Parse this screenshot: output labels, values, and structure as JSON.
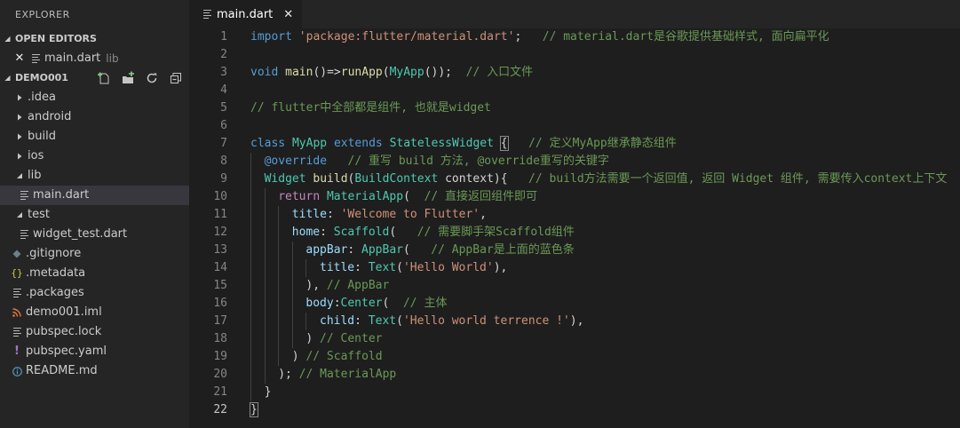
{
  "explorer": {
    "title": "EXPLORER",
    "open_editors": {
      "header": "OPEN EDITORS",
      "items": [
        {
          "name": "main.dart",
          "desc": "lib"
        }
      ]
    },
    "project": {
      "header": "DEMO001",
      "actions": [
        "new-file-icon",
        "new-folder-icon",
        "refresh-icon",
        "collapse-all-icon"
      ],
      "tree": [
        {
          "label": ".idea",
          "type": "folder",
          "expanded": false,
          "depth": 0
        },
        {
          "label": "android",
          "type": "folder",
          "expanded": false,
          "depth": 0
        },
        {
          "label": "build",
          "type": "folder",
          "expanded": false,
          "depth": 0
        },
        {
          "label": "ios",
          "type": "folder",
          "expanded": false,
          "depth": 0
        },
        {
          "label": "lib",
          "type": "folder",
          "expanded": true,
          "depth": 0
        },
        {
          "label": "main.dart",
          "type": "file-lines",
          "depth": 1,
          "selected": true
        },
        {
          "label": "test",
          "type": "folder",
          "expanded": true,
          "depth": 0
        },
        {
          "label": "widget_test.dart",
          "type": "file-lines",
          "depth": 1
        },
        {
          "label": ".gitignore",
          "type": "git",
          "depth": 0
        },
        {
          "label": ".metadata",
          "type": "json",
          "depth": 0
        },
        {
          "label": ".packages",
          "type": "file-lines",
          "depth": 0
        },
        {
          "label": "demo001.iml",
          "type": "rss",
          "depth": 0
        },
        {
          "label": "pubspec.lock",
          "type": "file-lines",
          "depth": 0
        },
        {
          "label": "pubspec.yaml",
          "type": "yaml",
          "depth": 0
        },
        {
          "label": "README.md",
          "type": "info",
          "depth": 0
        }
      ]
    }
  },
  "editor": {
    "tab": {
      "label": "main.dart"
    },
    "current_line": 22,
    "colors": {
      "keyword": "#569cd6",
      "control": "#c586c0",
      "string": "#ce9178",
      "comment": "#6a9955",
      "function": "#dcdcaa",
      "type": "#4ec9b0",
      "variable": "#9cdcfe",
      "plain": "#d4d4d4"
    },
    "lines": [
      {
        "n": "1",
        "indent": 0,
        "tokens": [
          [
            "kw",
            "import"
          ],
          [
            "p",
            " "
          ],
          [
            "str",
            "'package:flutter/material.dart'"
          ],
          [
            "p",
            ";   "
          ],
          [
            "com",
            "// material.dart是谷歌提供基础样式, 面向扁平化"
          ]
        ]
      },
      {
        "n": "2",
        "indent": 0,
        "tokens": []
      },
      {
        "n": "3",
        "indent": 0,
        "tokens": [
          [
            "kw",
            "void"
          ],
          [
            "p",
            " "
          ],
          [
            "fn",
            "main"
          ],
          [
            "p",
            "()=>"
          ],
          [
            "fn",
            "runApp"
          ],
          [
            "p",
            "("
          ],
          [
            "type",
            "MyApp"
          ],
          [
            "p",
            "());  "
          ],
          [
            "com",
            "// 入口文件"
          ]
        ]
      },
      {
        "n": "4",
        "indent": 0,
        "tokens": []
      },
      {
        "n": "5",
        "indent": 0,
        "tokens": [
          [
            "com",
            "// flutter中全部都是组件, 也就是widget"
          ]
        ]
      },
      {
        "n": "6",
        "indent": 0,
        "tokens": []
      },
      {
        "n": "7",
        "indent": 0,
        "tokens": [
          [
            "kw",
            "class"
          ],
          [
            "p",
            " "
          ],
          [
            "type",
            "MyApp"
          ],
          [
            "p",
            " "
          ],
          [
            "kw",
            "extends"
          ],
          [
            "p",
            " "
          ],
          [
            "type",
            "StatelessWidget"
          ],
          [
            "p",
            " "
          ],
          [
            "bm",
            "{"
          ],
          [
            "p",
            "   "
          ],
          [
            "com",
            "// 定义MyApp继承静态组件"
          ]
        ]
      },
      {
        "n": "8",
        "indent": 1,
        "tokens": [
          [
            "kw",
            "@override"
          ],
          [
            "p",
            "   "
          ],
          [
            "com",
            "// 重写 build 方法, @override重写的关键字"
          ]
        ]
      },
      {
        "n": "9",
        "indent": 1,
        "tokens": [
          [
            "type",
            "Widget"
          ],
          [
            "p",
            " "
          ],
          [
            "fn",
            "build"
          ],
          [
            "p",
            "("
          ],
          [
            "type",
            "BuildContext"
          ],
          [
            "p",
            " context){   "
          ],
          [
            "com",
            "// build方法需要一个返回值, 返回 Widget 组件, 需要传入context上下文"
          ]
        ]
      },
      {
        "n": "10",
        "indent": 2,
        "tokens": [
          [
            "flow",
            "return"
          ],
          [
            "p",
            " "
          ],
          [
            "type",
            "MaterialApp"
          ],
          [
            "p",
            "(  "
          ],
          [
            "com",
            "// 直接返回组件即可"
          ]
        ]
      },
      {
        "n": "11",
        "indent": 3,
        "tokens": [
          [
            "var",
            "title"
          ],
          [
            "p",
            ": "
          ],
          [
            "str",
            "'Welcome to Flutter'"
          ],
          [
            "p",
            ","
          ]
        ]
      },
      {
        "n": "12",
        "indent": 3,
        "tokens": [
          [
            "var",
            "home"
          ],
          [
            "p",
            ": "
          ],
          [
            "type",
            "Scaffold"
          ],
          [
            "p",
            "(   "
          ],
          [
            "com",
            "// 需要脚手架Scaffold组件"
          ]
        ]
      },
      {
        "n": "13",
        "indent": 4,
        "tokens": [
          [
            "var",
            "appBar"
          ],
          [
            "p",
            ": "
          ],
          [
            "type",
            "AppBar"
          ],
          [
            "p",
            "(   "
          ],
          [
            "com",
            "// AppBar是上面的蓝色条"
          ]
        ]
      },
      {
        "n": "14",
        "indent": 5,
        "tokens": [
          [
            "var",
            "title"
          ],
          [
            "p",
            ": "
          ],
          [
            "type",
            "Text"
          ],
          [
            "p",
            "("
          ],
          [
            "str",
            "'Hello World'"
          ],
          [
            "p",
            "),"
          ]
        ]
      },
      {
        "n": "15",
        "indent": 4,
        "tokens": [
          [
            "p",
            "), "
          ],
          [
            "com",
            "// AppBar"
          ]
        ]
      },
      {
        "n": "16",
        "indent": 4,
        "tokens": [
          [
            "var",
            "body"
          ],
          [
            "p",
            ":"
          ],
          [
            "type",
            "Center"
          ],
          [
            "p",
            "(  "
          ],
          [
            "com",
            "// 主体"
          ]
        ]
      },
      {
        "n": "17",
        "indent": 5,
        "tokens": [
          [
            "var",
            "child"
          ],
          [
            "p",
            ": "
          ],
          [
            "type",
            "Text"
          ],
          [
            "p",
            "("
          ],
          [
            "str",
            "'Hello world terrence !'"
          ],
          [
            "p",
            "),"
          ]
        ]
      },
      {
        "n": "18",
        "indent": 4,
        "tokens": [
          [
            "p",
            ") "
          ],
          [
            "com",
            "// Center"
          ]
        ]
      },
      {
        "n": "19",
        "indent": 3,
        "tokens": [
          [
            "p",
            ") "
          ],
          [
            "com",
            "// Scaffold"
          ]
        ]
      },
      {
        "n": "20",
        "indent": 2,
        "tokens": [
          [
            "p",
            "); "
          ],
          [
            "com",
            "// MaterialApp"
          ]
        ]
      },
      {
        "n": "21",
        "indent": 1,
        "tokens": [
          [
            "p",
            "}"
          ]
        ]
      },
      {
        "n": "22",
        "indent": 0,
        "tokens": [
          [
            "bm",
            "}"
          ]
        ]
      }
    ]
  }
}
